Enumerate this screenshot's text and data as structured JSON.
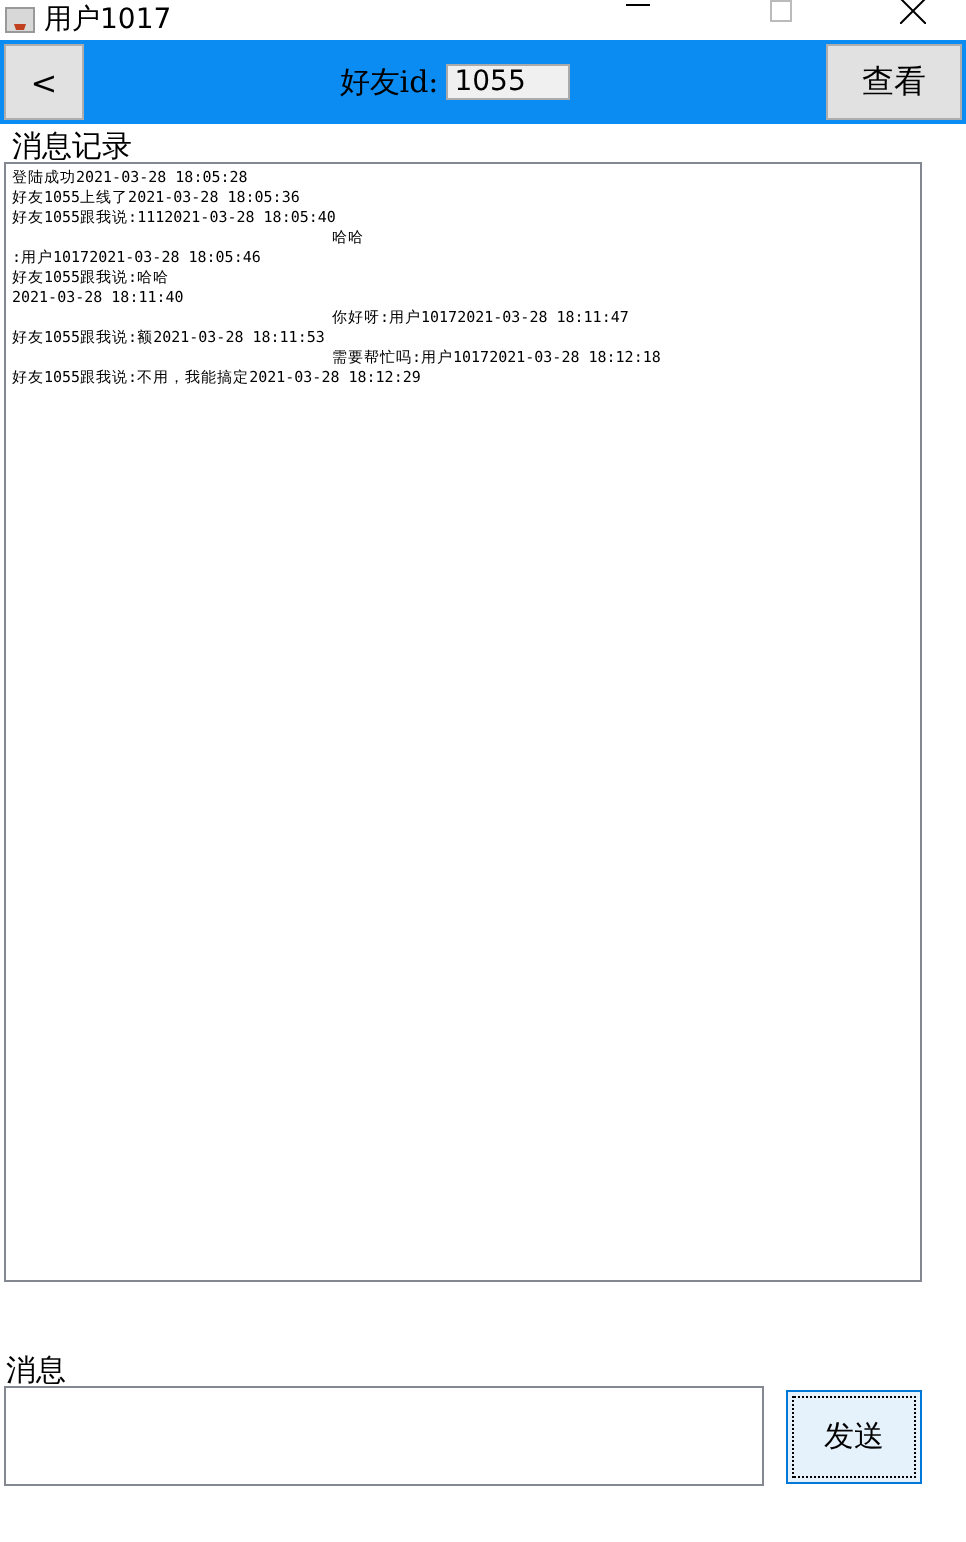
{
  "window": {
    "title": "用户1017"
  },
  "header": {
    "back_button": "<",
    "friend_label": "好友id:",
    "friend_id": "1055",
    "view_button": "查看"
  },
  "log": {
    "label": "消息记录",
    "lines": [
      {
        "kind": "left",
        "text": "登陆成功2021-03-28 18:05:28"
      },
      {
        "kind": "left",
        "text": "好友1055上线了2021-03-28 18:05:36"
      },
      {
        "kind": "left",
        "text": "好友1055跟我说:1112021-03-28 18:05:40"
      },
      {
        "kind": "right",
        "text": "哈哈"
      },
      {
        "kind": "left",
        "text": ":用户10172021-03-28 18:05:46"
      },
      {
        "kind": "left",
        "text": "好友1055跟我说:哈哈"
      },
      {
        "kind": "left",
        "text": "2021-03-28 18:11:40"
      },
      {
        "kind": "right",
        "text": "你好呀:用户10172021-03-28 18:11:47"
      },
      {
        "kind": "left",
        "text": "好友1055跟我说:额2021-03-28 18:11:53"
      },
      {
        "kind": "right",
        "text": "需要帮忙吗:用户10172021-03-28 18:12:18"
      },
      {
        "kind": "left",
        "text": "好友1055跟我说:不用，我能搞定2021-03-28 18:12:29"
      }
    ]
  },
  "compose": {
    "label": "消息",
    "send_button": "发送"
  }
}
